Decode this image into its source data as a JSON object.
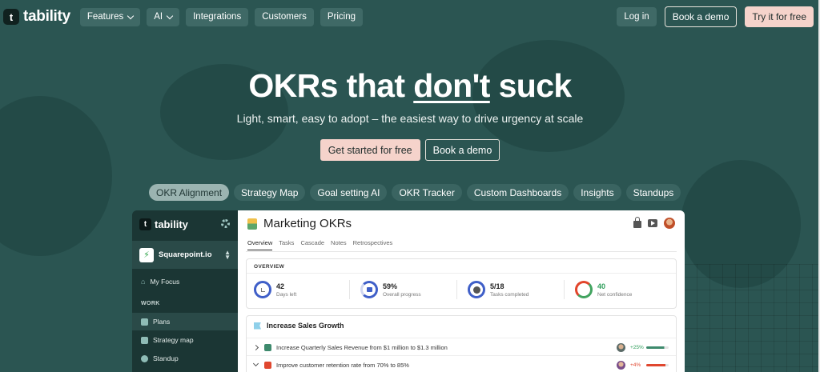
{
  "nav": {
    "logo_text": "tability",
    "logo_mark": "t",
    "items": [
      {
        "label": "Features",
        "has_dropdown": true
      },
      {
        "label": "AI",
        "has_dropdown": true
      },
      {
        "label": "Integrations",
        "has_dropdown": false
      },
      {
        "label": "Customers",
        "has_dropdown": false
      },
      {
        "label": "Pricing",
        "has_dropdown": false
      }
    ],
    "login": "Log in",
    "book_demo": "Book a demo",
    "try_free": "Try it for free"
  },
  "hero": {
    "title_part1": "OKRs that ",
    "title_underlined": "don't",
    "title_part2": " suck",
    "subtitle": "Light, smart, easy to adopt – the easiest way to drive urgency at scale",
    "cta_primary": "Get started for free",
    "cta_secondary": "Book a demo"
  },
  "feature_tabs": [
    {
      "label": "OKR Alignment",
      "active": true
    },
    {
      "label": "Strategy Map",
      "active": false
    },
    {
      "label": "Goal setting AI",
      "active": false
    },
    {
      "label": "OKR Tracker",
      "active": false
    },
    {
      "label": "Custom Dashboards",
      "active": false
    },
    {
      "label": "Insights",
      "active": false
    },
    {
      "label": "Standups",
      "active": false
    }
  ],
  "app": {
    "sidebar": {
      "logo_text": "tability",
      "workspace": "Squarepoint.io",
      "my_focus": "My Focus",
      "section_work": "WORK",
      "items": [
        {
          "label": "Plans",
          "selected": true
        },
        {
          "label": "Strategy map",
          "selected": false
        },
        {
          "label": "Standup",
          "selected": false
        }
      ]
    },
    "main": {
      "title": "Marketing OKRs",
      "tabs": [
        "Overview",
        "Tasks",
        "Cascade",
        "Notes",
        "Retrospectives"
      ],
      "overview_heading": "OVERVIEW",
      "stats": [
        {
          "value": "42",
          "label": "Days left"
        },
        {
          "value": "59%",
          "label": "Overall progress"
        },
        {
          "value": "5/18",
          "label": "Tasks completed"
        },
        {
          "value": "40",
          "label": "Net confidence"
        }
      ],
      "goal_title": "Increase Sales Growth",
      "key_results": [
        {
          "text": "Increase Quarterly Sales Revenue from $1 million to $1.3 million",
          "change": "+25%",
          "color": "#3e8a6d",
          "progress": 0.8
        },
        {
          "text": "Improve customer retention rate from 70% to 85%",
          "change": "+4%",
          "color": "#e0472f",
          "progress": 0.85
        }
      ]
    }
  },
  "colors": {
    "background": "#2b5552",
    "accent_peach": "#f5d3cb",
    "success": "#2f9e5b",
    "danger": "#e0472f"
  }
}
